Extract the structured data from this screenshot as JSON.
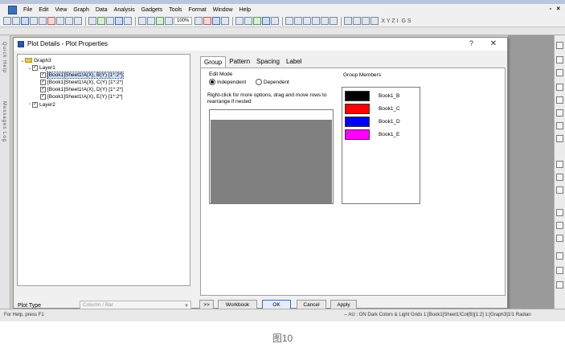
{
  "menubar": {
    "items": [
      "File",
      "Edit",
      "View",
      "Graph",
      "Data",
      "Analysis",
      "Gadgets",
      "Tools",
      "Format",
      "Window",
      "Help"
    ],
    "window_controls": [
      "-",
      "×"
    ]
  },
  "toolbar": {
    "zoom": "100%",
    "letters": "X Y Z I",
    "tail": "G S"
  },
  "left_dock": {
    "labels": [
      "Quick Help",
      "Messages Log"
    ]
  },
  "dialog": {
    "title": "Plot Details - Plot Properties",
    "help_glyph": "?",
    "close_glyph": "✕",
    "tree": {
      "root": "Graph3",
      "layer1": "Layer1",
      "plots": [
        "[Book1]Sheet1!A(X), B(Y) [1*:2*]",
        "[Book1]Sheet1!A(X), C(Y) [1*:2*]",
        "[Book1]Sheet1!A(X), D(Y) [1*:2*]",
        "[Book1]Sheet1!A(X), E(Y) [1*:2*]"
      ],
      "layer2": "Layer2"
    },
    "tabs": [
      "Group",
      "Pattern",
      "Spacing",
      "Label"
    ],
    "group_tab": {
      "edit_mode_label": "Edit Mode",
      "independent_label": "Independent",
      "dependent_label": "Dependent",
      "hint": "Right-click for more options, drag and move rows to  rearrange if nested",
      "members_label": "Group Members",
      "members": [
        {
          "name": "Book1_B",
          "color": "#000000"
        },
        {
          "name": "Book1_C",
          "color": "#ff0000"
        },
        {
          "name": "Book1_D",
          "color": "#0000ff"
        },
        {
          "name": "Book1_E",
          "color": "#ff00ff"
        }
      ],
      "group_fill_color": "#808080"
    },
    "plot_type_label": "Plot Type",
    "plot_type_value": "Column / Bar",
    "buttons": {
      "expand": ">>",
      "workbook": "Workbook",
      "ok": "OK",
      "cancel": "Cancel",
      "apply": "Apply"
    }
  },
  "status": {
    "left": "For Help, press F1",
    "right": "-- AU : ON  Dark Colors & Light Grids  1:[Book1]Sheet1!Col(B)[1:2]  1:[Graph3]1!1  Radian"
  },
  "caption": "图10"
}
